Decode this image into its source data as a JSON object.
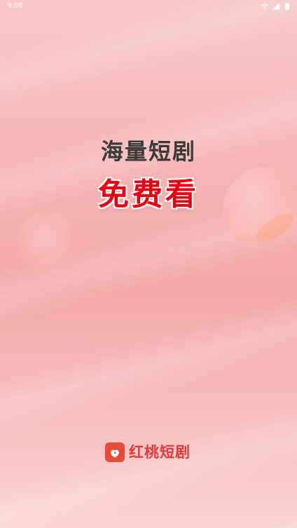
{
  "status_bar": {
    "time": "9:08",
    "icons": [
      "wifi-icon",
      "signal-icon",
      "battery-icon"
    ]
  },
  "splash": {
    "headline": "海量短剧",
    "highlight": "免费看",
    "colors": {
      "headline": "#3a3a3a",
      "highlight": "#e60012",
      "brand": "#e2393c"
    }
  },
  "brand": {
    "logo_icon": "peach-play-icon",
    "name": "红桃短剧"
  }
}
